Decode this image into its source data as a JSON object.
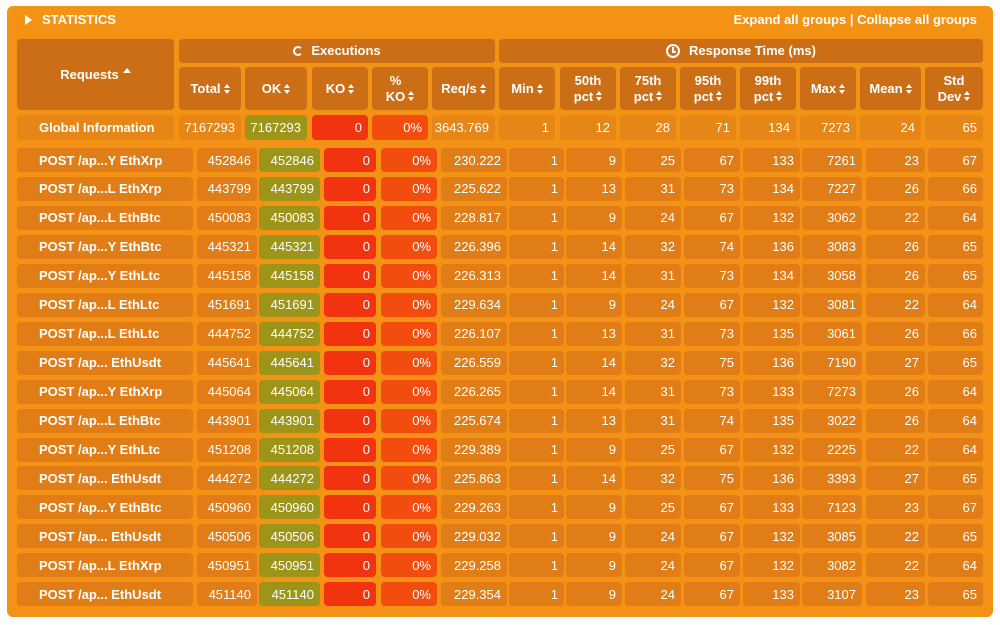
{
  "header": {
    "title": "STATISTICS",
    "expand_all": "Expand all groups",
    "separator": "|",
    "collapse_all": "Collapse all groups"
  },
  "groups": {
    "executions": "Executions",
    "response_time": "Response Time (ms)"
  },
  "columns": {
    "requests": "Requests",
    "total": "Total",
    "ok": "OK",
    "ko": "KO",
    "pct_ko_line1": "%",
    "pct_ko_line2": "KO",
    "reqs": "Req/s",
    "min": "Min",
    "p50_line1": "50th",
    "p50_line2": "pct",
    "p75_line1": "75th",
    "p75_line2": "pct",
    "p95_line1": "95th",
    "p95_line2": "pct",
    "p99_line1": "99th",
    "p99_line2": "pct",
    "max": "Max",
    "mean": "Mean",
    "std_line1": "Std",
    "std_line2": "Dev"
  },
  "global": [
    "Global Information",
    "7167293",
    "7167293",
    "0",
    "0%",
    "3643.769",
    "1",
    "12",
    "28",
    "71",
    "134",
    "7273",
    "24",
    "65"
  ],
  "rows": [
    [
      "POST /ap...Y EthXrp",
      "452846",
      "452846",
      "0",
      "0%",
      "230.222",
      "1",
      "9",
      "25",
      "67",
      "133",
      "7261",
      "23",
      "67"
    ],
    [
      "POST /ap...L EthXrp",
      "443799",
      "443799",
      "0",
      "0%",
      "225.622",
      "1",
      "13",
      "31",
      "73",
      "134",
      "7227",
      "26",
      "66"
    ],
    [
      "POST /ap...L EthBtc",
      "450083",
      "450083",
      "0",
      "0%",
      "228.817",
      "1",
      "9",
      "24",
      "67",
      "132",
      "3062",
      "22",
      "64"
    ],
    [
      "POST /ap...Y EthBtc",
      "445321",
      "445321",
      "0",
      "0%",
      "226.396",
      "1",
      "14",
      "32",
      "74",
      "136",
      "3083",
      "26",
      "65"
    ],
    [
      "POST /ap...Y EthLtc",
      "445158",
      "445158",
      "0",
      "0%",
      "226.313",
      "1",
      "14",
      "31",
      "73",
      "134",
      "3058",
      "26",
      "65"
    ],
    [
      "POST /ap...L EthLtc",
      "451691",
      "451691",
      "0",
      "0%",
      "229.634",
      "1",
      "9",
      "24",
      "67",
      "132",
      "3081",
      "22",
      "64"
    ],
    [
      "POST /ap...L EthLtc",
      "444752",
      "444752",
      "0",
      "0%",
      "226.107",
      "1",
      "13",
      "31",
      "73",
      "135",
      "3061",
      "26",
      "66"
    ],
    [
      "POST /ap... EthUsdt",
      "445641",
      "445641",
      "0",
      "0%",
      "226.559",
      "1",
      "14",
      "32",
      "75",
      "136",
      "7190",
      "27",
      "65"
    ],
    [
      "POST /ap...Y EthXrp",
      "445064",
      "445064",
      "0",
      "0%",
      "226.265",
      "1",
      "14",
      "31",
      "73",
      "133",
      "7273",
      "26",
      "64"
    ],
    [
      "POST /ap...L EthBtc",
      "443901",
      "443901",
      "0",
      "0%",
      "225.674",
      "1",
      "13",
      "31",
      "74",
      "135",
      "3022",
      "26",
      "64"
    ],
    [
      "POST /ap...Y EthLtc",
      "451208",
      "451208",
      "0",
      "0%",
      "229.389",
      "1",
      "9",
      "25",
      "67",
      "132",
      "2225",
      "22",
      "64"
    ],
    [
      "POST /ap... EthUsdt",
      "444272",
      "444272",
      "0",
      "0%",
      "225.863",
      "1",
      "14",
      "32",
      "75",
      "136",
      "3393",
      "27",
      "65"
    ],
    [
      "POST /ap...Y EthBtc",
      "450960",
      "450960",
      "0",
      "0%",
      "229.263",
      "1",
      "9",
      "25",
      "67",
      "133",
      "7123",
      "23",
      "67"
    ],
    [
      "POST /ap... EthUsdt",
      "450506",
      "450506",
      "0",
      "0%",
      "229.032",
      "1",
      "9",
      "24",
      "67",
      "132",
      "3085",
      "22",
      "65"
    ],
    [
      "POST /ap...L EthXrp",
      "450951",
      "450951",
      "0",
      "0%",
      "229.258",
      "1",
      "9",
      "24",
      "67",
      "132",
      "3082",
      "22",
      "64"
    ],
    [
      "POST /ap... EthUsdt",
      "451140",
      "451140",
      "0",
      "0%",
      "229.354",
      "1",
      "9",
      "24",
      "67",
      "133",
      "3107",
      "23",
      "65"
    ]
  ],
  "colors": {
    "panel": "#f39214",
    "header_cell": "#cc6e16",
    "ok": "#9d941a",
    "ko": "#f2330f",
    "pct_ko": "#f24d0f"
  }
}
